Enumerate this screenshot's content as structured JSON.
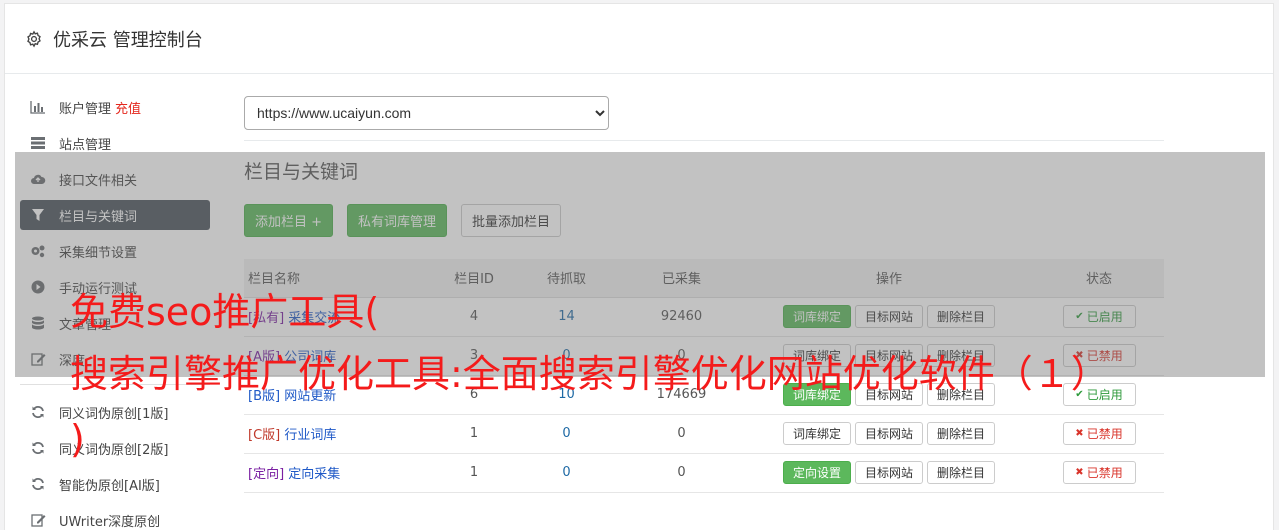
{
  "header": {
    "title": "优采云 管理控制台",
    "icon": "gear-icon"
  },
  "sidebar": {
    "items": [
      {
        "label": "账户管理",
        "extra": "充值",
        "icon": "bar-chart-icon"
      },
      {
        "label": "站点管理",
        "icon": "server-icon"
      },
      {
        "label": "接口文件相关",
        "icon": "cloud-upload-icon"
      },
      {
        "label": "栏目与关键词",
        "icon": "filter-icon",
        "active": true
      },
      {
        "label": "采集细节设置",
        "icon": "cogs-icon"
      },
      {
        "label": "手动运行测试",
        "icon": "play-circle-icon"
      },
      {
        "label": "文章管理",
        "icon": "database-icon"
      },
      {
        "label": "深度",
        "icon": "edit-icon"
      }
    ],
    "items2": [
      {
        "label": "同义词伪原创[1版]",
        "icon": "refresh-icon"
      },
      {
        "label": "同义词伪原创[2版]",
        "icon": "refresh-icon"
      },
      {
        "label": "智能伪原创[AI版]",
        "icon": "refresh-icon"
      },
      {
        "label": "UWriter深度原创",
        "icon": "edit-icon"
      }
    ]
  },
  "main": {
    "site_select": "https://www.ucaiyun.com",
    "section_title": "栏目与关键词",
    "buttons": {
      "add": "添加栏目 +",
      "private_lib": "私有词库管理",
      "batch_add": "批量添加栏目"
    },
    "table": {
      "headers": [
        "栏目名称",
        "栏目ID",
        "待抓取",
        "已采集",
        "操作",
        "状态"
      ],
      "rows": [
        {
          "tag": "[私有]",
          "name": "采集交流",
          "id": "4",
          "pending": "14",
          "collected": "92460",
          "op1": "词库绑定",
          "op1_green": true,
          "op2": "目标网站",
          "op3": "删除栏目",
          "status": "已启用",
          "on": true
        },
        {
          "tag": "[A版]",
          "name": "公司词库",
          "id": "3",
          "pending": "0",
          "collected": "0",
          "op1": "词库绑定",
          "op1_green": false,
          "op2": "目标网站",
          "op3": "删除栏目",
          "status": "已禁用",
          "on": false
        },
        {
          "tag": "[B版]",
          "name": "网站更新",
          "id": "6",
          "pending": "10",
          "collected": "174669",
          "op1": "词库绑定",
          "op1_green": true,
          "op2": "目标网站",
          "op3": "删除栏目",
          "status": "已启用",
          "on": true
        },
        {
          "tag": "[C版]",
          "name": "行业词库",
          "id": "1",
          "pending": "0",
          "collected": "0",
          "op1": "词库绑定",
          "op1_green": false,
          "op2": "目标网站",
          "op3": "删除栏目",
          "status": "已禁用",
          "on": false
        },
        {
          "tag": "[定向]",
          "name": "定向采集",
          "id": "1",
          "pending": "0",
          "collected": "0",
          "op1": "定向设置",
          "op1_green": true,
          "op2": "目标网站",
          "op3": "删除栏目",
          "status": "已禁用",
          "on": false
        }
      ]
    }
  },
  "overlay_text": {
    "line1": "免费seo推广工具(",
    "line2": "搜索引擎推广优化工具:全面搜索引擎优化网站优化软件（１）",
    "line3": ")"
  },
  "colors": {
    "active_nav": "#4a535c",
    "green": "#5cb85c",
    "red_text": "#f41b1b"
  }
}
